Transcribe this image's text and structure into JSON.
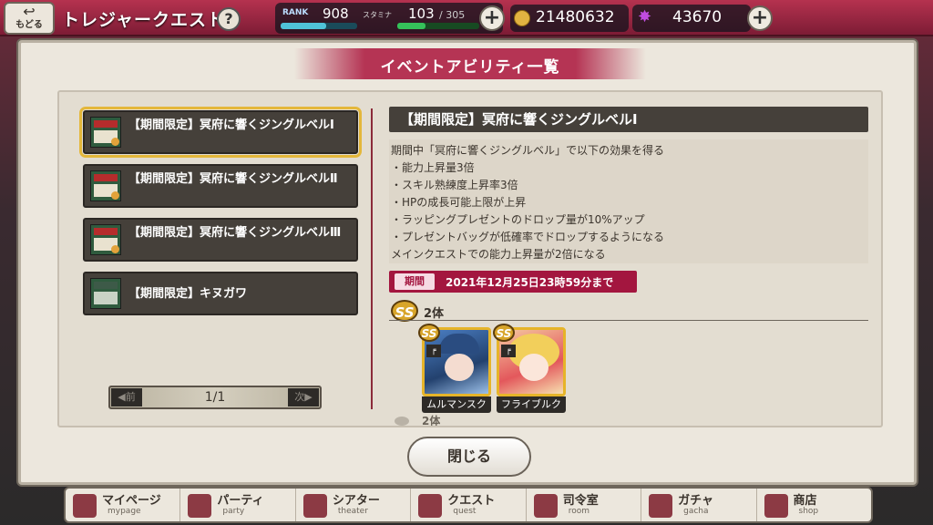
{
  "header": {
    "back_label": "もどる",
    "title": "トレジャークエスト",
    "help": "?",
    "rank_label": "RANK",
    "rank_value": "908",
    "stamina_label": "スタミナ",
    "stamina_value": "103",
    "stamina_max": "/ 305",
    "stamina_fraction": 0.34,
    "plus": "+",
    "coins": "21480632",
    "gems": "43670"
  },
  "modal": {
    "title": "イベントアビリティ一覧",
    "list": [
      {
        "name": "【期間限定】冥府に響くジングルベルⅠ",
        "selected": true
      },
      {
        "name": "【期間限定】冥府に響くジングルベルⅡ",
        "selected": false
      },
      {
        "name": "【期間限定】冥府に響くジングルベルⅢ",
        "selected": false
      },
      {
        "name": "【期間限定】キヌガワ",
        "selected": false
      }
    ],
    "pager": {
      "prev": "◀前",
      "page": "1/1",
      "next": "次▶"
    },
    "detail": {
      "title": "【期間限定】冥府に響くジングルベルⅠ",
      "lines": [
        "期間中「冥府に響くジングルベル」で以下の効果を得る",
        "・能力上昇量3倍",
        "・スキル熟練度上昇率3倍",
        "・HPの成長可能上限が上昇",
        "・ラッピングプレゼントのドロップ量が10%アップ",
        "・プレゼントバッグが低確率でドロップするようになる",
        "メインクエストでの能力上昇量が2倍になる"
      ],
      "period_label": "期間",
      "period_text": "2021年12月25日23時59分まで",
      "rank_badge": "SS",
      "count": "2体",
      "characters": [
        {
          "name": "ムルマンスク",
          "badge": "SS"
        },
        {
          "name": "フライブルク",
          "badge": "SS"
        }
      ],
      "next_count": "2体"
    },
    "close_label": "閉じる"
  },
  "nav": [
    {
      "label": "マイページ",
      "sub": "mypage"
    },
    {
      "label": "パーティ",
      "sub": "party"
    },
    {
      "label": "シアター",
      "sub": "theater"
    },
    {
      "label": "クエスト",
      "sub": "quest"
    },
    {
      "label": "司令室",
      "sub": "room"
    },
    {
      "label": "ガチャ",
      "sub": "gacha"
    },
    {
      "label": "商店",
      "sub": "shop"
    }
  ]
}
